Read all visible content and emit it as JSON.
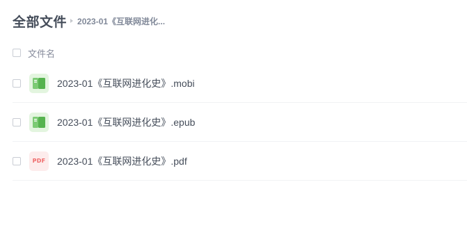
{
  "header": {
    "title": "全部文件",
    "breadcrumb": "2023-01《互联网进化..."
  },
  "list": {
    "column_name": "文件名",
    "rows": [
      {
        "name": "2023-01《互联网进化史》.mobi",
        "icon": "ebook-icon"
      },
      {
        "name": "2023-01《互联网进化史》.epub",
        "icon": "ebook-icon"
      },
      {
        "name": "2023-01《互联网进化史》.pdf",
        "icon": "pdf-icon",
        "icon_label": "PDF"
      }
    ]
  },
  "colors": {
    "title": "#454d5a",
    "book_icon_bg": "#e3f5df",
    "book_icon": "#5bb85a",
    "pdf_icon_bg": "#fdecec",
    "pdf_icon": "#ef6a6a"
  }
}
